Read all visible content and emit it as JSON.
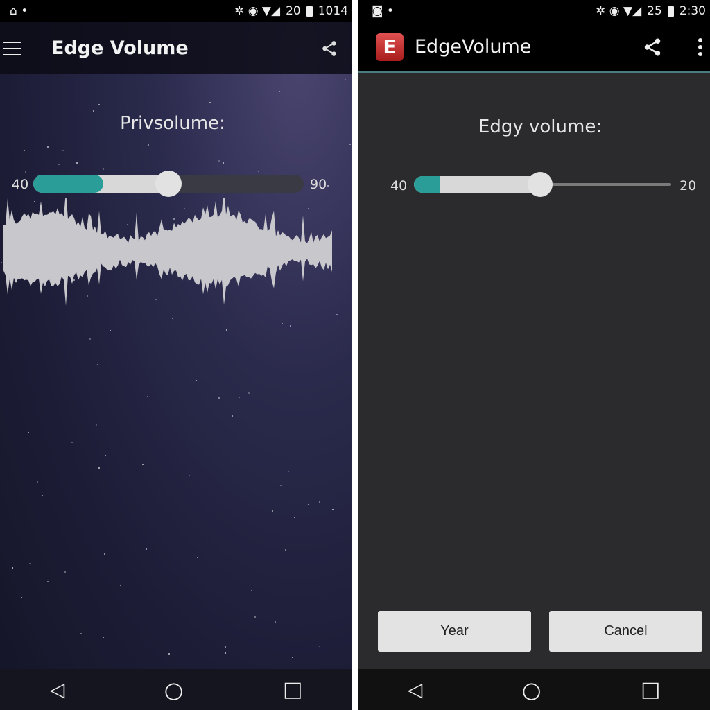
{
  "left": {
    "status": {
      "left_icons": "⌂ •",
      "right_icons": "✲ ◉ ▼◢",
      "battery_level": "20",
      "time": "1014"
    },
    "appbar": {
      "title": "Edge Volume",
      "menu_icon": "hamburger-icon",
      "share_icon": "share-icon"
    },
    "heading": "Privsolume:",
    "slider": {
      "min_label": "40",
      "max_label": "90",
      "fill_percent": 26,
      "thumb_percent": 50,
      "colors": {
        "fill": "#2a9d98",
        "track": "#d8d8d8",
        "rest": "#3a3a44"
      }
    }
  },
  "right": {
    "status": {
      "left_icons": "◙ •",
      "right_icons": "✲ ◉ ▼◢",
      "battery_level": "25",
      "time": "2:30"
    },
    "appbar": {
      "title": "EdgeVolume",
      "logo": "E",
      "share_icon": "share-icon",
      "more_icon": "more-vert-icon"
    },
    "heading": "Edgy volume:",
    "slider": {
      "min_label": "40",
      "max_label": "20",
      "fill_percent": 10,
      "thumb_percent": 49,
      "colors": {
        "fill": "#2a9d98",
        "track": "#d8d8d8",
        "rest": "#7a7a7a"
      }
    },
    "buttons": {
      "confirm": "Year",
      "cancel": "Cancel"
    }
  },
  "navbar": {
    "back": "◁",
    "home": "○",
    "recents": "□"
  }
}
